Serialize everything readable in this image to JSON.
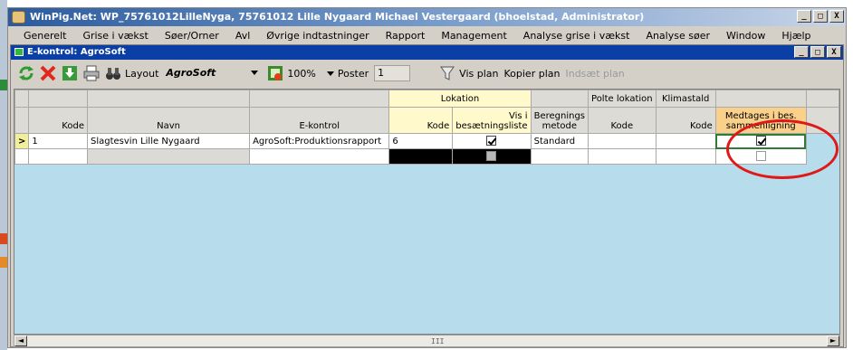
{
  "app": {
    "title": "WinPig.Net: WP_75761012LilleNyga, 75761012 Lille Nygaard Michael Vestergaard (bhoelstad, Administrator)",
    "window_buttons": [
      "_",
      "□",
      "X"
    ]
  },
  "menu": [
    "Generelt",
    "Grise i vækst",
    "Søer/Orner",
    "Avl",
    "Øvrige indtastninger",
    "Rapport",
    "Management",
    "Analyse grise i vækst",
    "Analyse søer",
    "Window",
    "Hjælp"
  ],
  "child_window": {
    "title": "E-kontrol: AgroSoft",
    "window_buttons": [
      "_",
      "□",
      "X"
    ]
  },
  "toolbar": {
    "layout_label": "Layout",
    "layout_value": "AgroSoft",
    "zoom": "100%",
    "poster_label": "Poster",
    "poster_value": "1",
    "vis_plan": "Vis plan",
    "kopier_plan": "Kopier plan",
    "indsaet_plan": "Indsæt plan"
  },
  "grid": {
    "group_headers": {
      "lokation": "Lokation",
      "polte_lokation": "Polte lokation",
      "klimastald": "Klimastald"
    },
    "columns": {
      "kode": "Kode",
      "navn": "Navn",
      "ekontrol": "E-kontrol",
      "lok_kode": "Kode",
      "vis_i_1": "Vis i",
      "vis_i_2": "besætningsliste",
      "beregning_1": "Beregnings",
      "beregning_2": "metode",
      "polte_kode": "Kode",
      "klima_kode": "Kode",
      "medtages_1": "Medtages i bes.",
      "medtages_2": "sammenligning"
    },
    "rows": [
      {
        "indicator": ">",
        "kode": "1",
        "navn": "Slagtesvin Lille Nygaard",
        "ekontrol": "AgroSoft:Produktionsrapport",
        "lok_kode": "6",
        "vis_i_besaetningsliste": true,
        "beregningsmetode": "Standard",
        "polte_kode": "",
        "klima_kode": "",
        "medtages": true
      }
    ]
  },
  "scrollbar": {
    "left": "◄",
    "right": "►",
    "grip": "III"
  },
  "colors": {
    "highlight_circle": "#e01818",
    "grid_background": "#b7dceb",
    "header_yellow": "#fff9cc",
    "header_orange": "#f9d18b"
  }
}
